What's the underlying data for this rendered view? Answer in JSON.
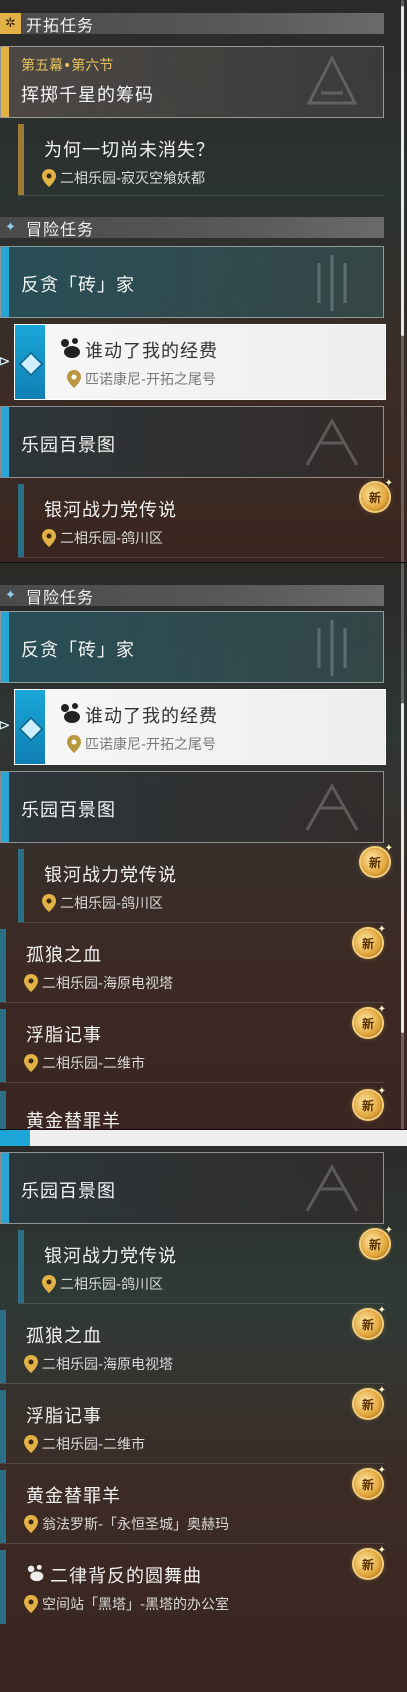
{
  "sections": {
    "trailblaze": "开拓任务",
    "adventure": "冒险任务"
  },
  "trailblaze_quest": {
    "chapter": "第五幕•第六节",
    "title": "挥掷千星的筹码",
    "sub_title": "为何一切尚未消失？",
    "sub_location": "二相乐园-寂灭空飨妖都"
  },
  "quests": {
    "q1": {
      "title": "反贪「砖」家"
    },
    "q2": {
      "title": "谁动了我的经费",
      "location": "匹诺康尼-开拓之尾号"
    },
    "q3": {
      "title": "乐园百景图"
    },
    "q4": {
      "title": "银河战力党传说",
      "location": "二相乐园-鸽川区"
    },
    "q5": {
      "title": "孤狼之血",
      "location": "二相乐园-海原电视塔"
    },
    "q6": {
      "title": "浮脂记事",
      "location": "二相乐园-二维市"
    },
    "q7": {
      "title": "黄金替罪羊",
      "location": "翁法罗斯-「永恒圣城」奥赫玛"
    },
    "q8": {
      "title": "二律背反的圆舞曲",
      "location": "空间站「黑塔」-黑塔的办公室"
    }
  },
  "badge": "新",
  "colors": {
    "gold_accent": "#e3b247",
    "blue_accent": "#2aa6d6",
    "new_badge": "#e1a53a"
  },
  "icons": [
    "trailblaze-icon",
    "adventure-icon",
    "location-pin-icon",
    "paw-icon",
    "new-badge-icon",
    "diamond-marker-icon"
  ]
}
